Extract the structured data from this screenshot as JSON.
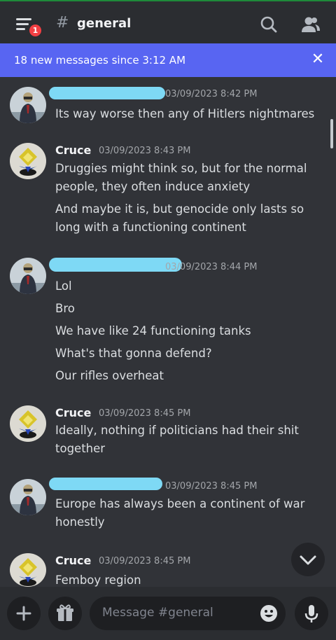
{
  "header": {
    "menu_badge": "1",
    "hash": "#",
    "channel_name": "general"
  },
  "banner": {
    "text": "18 new messages since 3:12 AM",
    "close": "✕"
  },
  "messages": [
    {
      "author": "",
      "timestamp": "03/09/2023 8:42 PM",
      "lines": [
        "Its way worse then any of Hitlers nightmares"
      ]
    },
    {
      "author": "Cruce",
      "timestamp": "03/09/2023 8:43 PM",
      "lines": [
        "Druggies might think so, but for the normal",
        "people, they often induce anxiety",
        "And maybe it is, but genocide only lasts so",
        "long with a functioning continent"
      ]
    },
    {
      "author": "",
      "timestamp": "03/09/2023 8:44 PM",
      "lines": [
        "Lol",
        "Bro",
        "We have like 24 functioning tanks",
        "What's that gonna defend?",
        "Our rifles overheat"
      ]
    },
    {
      "author": "Cruce",
      "timestamp": "03/09/2023 8:45 PM",
      "lines": [
        "Ideally, nothing if politicians had their shit",
        "together"
      ]
    },
    {
      "author": "",
      "timestamp": "03/09/2023 8:45 PM",
      "lines": [
        "Europe has always been a continent of war",
        "honestly"
      ]
    },
    {
      "author": "Cruce",
      "timestamp": "03/09/2023 8:45 PM",
      "lines": [
        "Femboy region"
      ]
    }
  ],
  "composer": {
    "placeholder": "Message #general"
  },
  "colors": {
    "background": "#313338",
    "header": "#2b2d31",
    "banner": "#5865f2",
    "badge": "#f23f43",
    "redaction": "#7ed9f5"
  },
  "icons": [
    "menu-icon",
    "search-icon",
    "members-icon",
    "close-icon",
    "chevron-down-icon",
    "plus-icon",
    "gift-icon",
    "emoji-icon",
    "microphone-icon"
  ]
}
